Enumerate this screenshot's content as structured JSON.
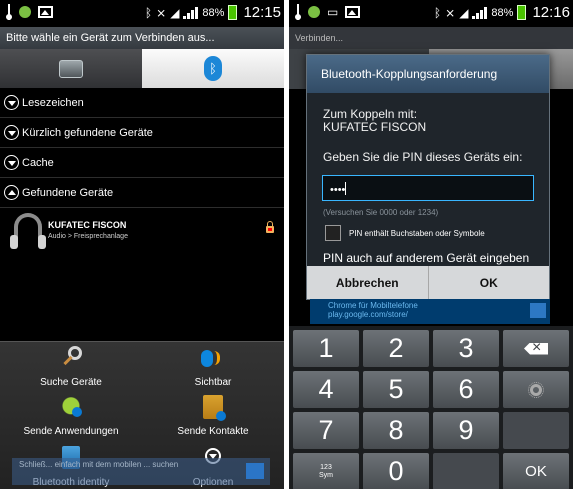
{
  "left": {
    "status_time": "12:15",
    "battery": "88%",
    "title": "Bitte wähle ein Gerät zum Verbinden aus...",
    "sections": [
      "Lesezeichen",
      "Kürzlich gefundene Geräte",
      "Cache",
      "Gefundene Geräte"
    ],
    "device": {
      "name": "KUFATEC FISCON",
      "type": "Audio > Freisprechanlage"
    },
    "menu": {
      "search_devices": "Suche Geräte",
      "visible": "Sichtbar",
      "send_apps": "Sende Anwendungen",
      "send_contacts": "Sende Kontakte",
      "bluetooth_identity": "Bluetooth identity",
      "options": "Optionen"
    },
    "ad_text": "Schließ... einfach mit dem mobilen ... suchen"
  },
  "right": {
    "status_time": "12:16",
    "battery": "88%",
    "background_title": "Verbinden...",
    "dialog": {
      "title": "Bluetooth-Kopplungsanforderung",
      "pair_with": "Zum Koppeln mit:",
      "device": "KUFATEC FISCON",
      "enter_pin": "Geben Sie die PIN dieses Geräts ein:",
      "pin_value": "••••",
      "hint": "(Versuchen Sie 0000 oder 1234)",
      "checkbox_label": "PIN enthält Buchstaben oder Symbole",
      "other_device": "PIN auch auf anderem Gerät eingeben",
      "cancel": "Abbrechen",
      "ok": "OK"
    },
    "ad": {
      "line1": "Chrome für Mobiltelefone",
      "line2": "play.google.com/store/"
    },
    "keypad": {
      "k1": "1",
      "k2": "2",
      "k3": "3",
      "k4": "4",
      "k5": "5",
      "k6": "6",
      "k7": "7",
      "k8": "8",
      "k9": "9",
      "k0": "0",
      "sym_top": "123",
      "sym_bottom": "Sym",
      "ok": "OK"
    }
  },
  "colors": {
    "bluetooth_blue": "#1c87d7",
    "pin_focus": "#39b6ff",
    "battery_green": "#49c300"
  }
}
